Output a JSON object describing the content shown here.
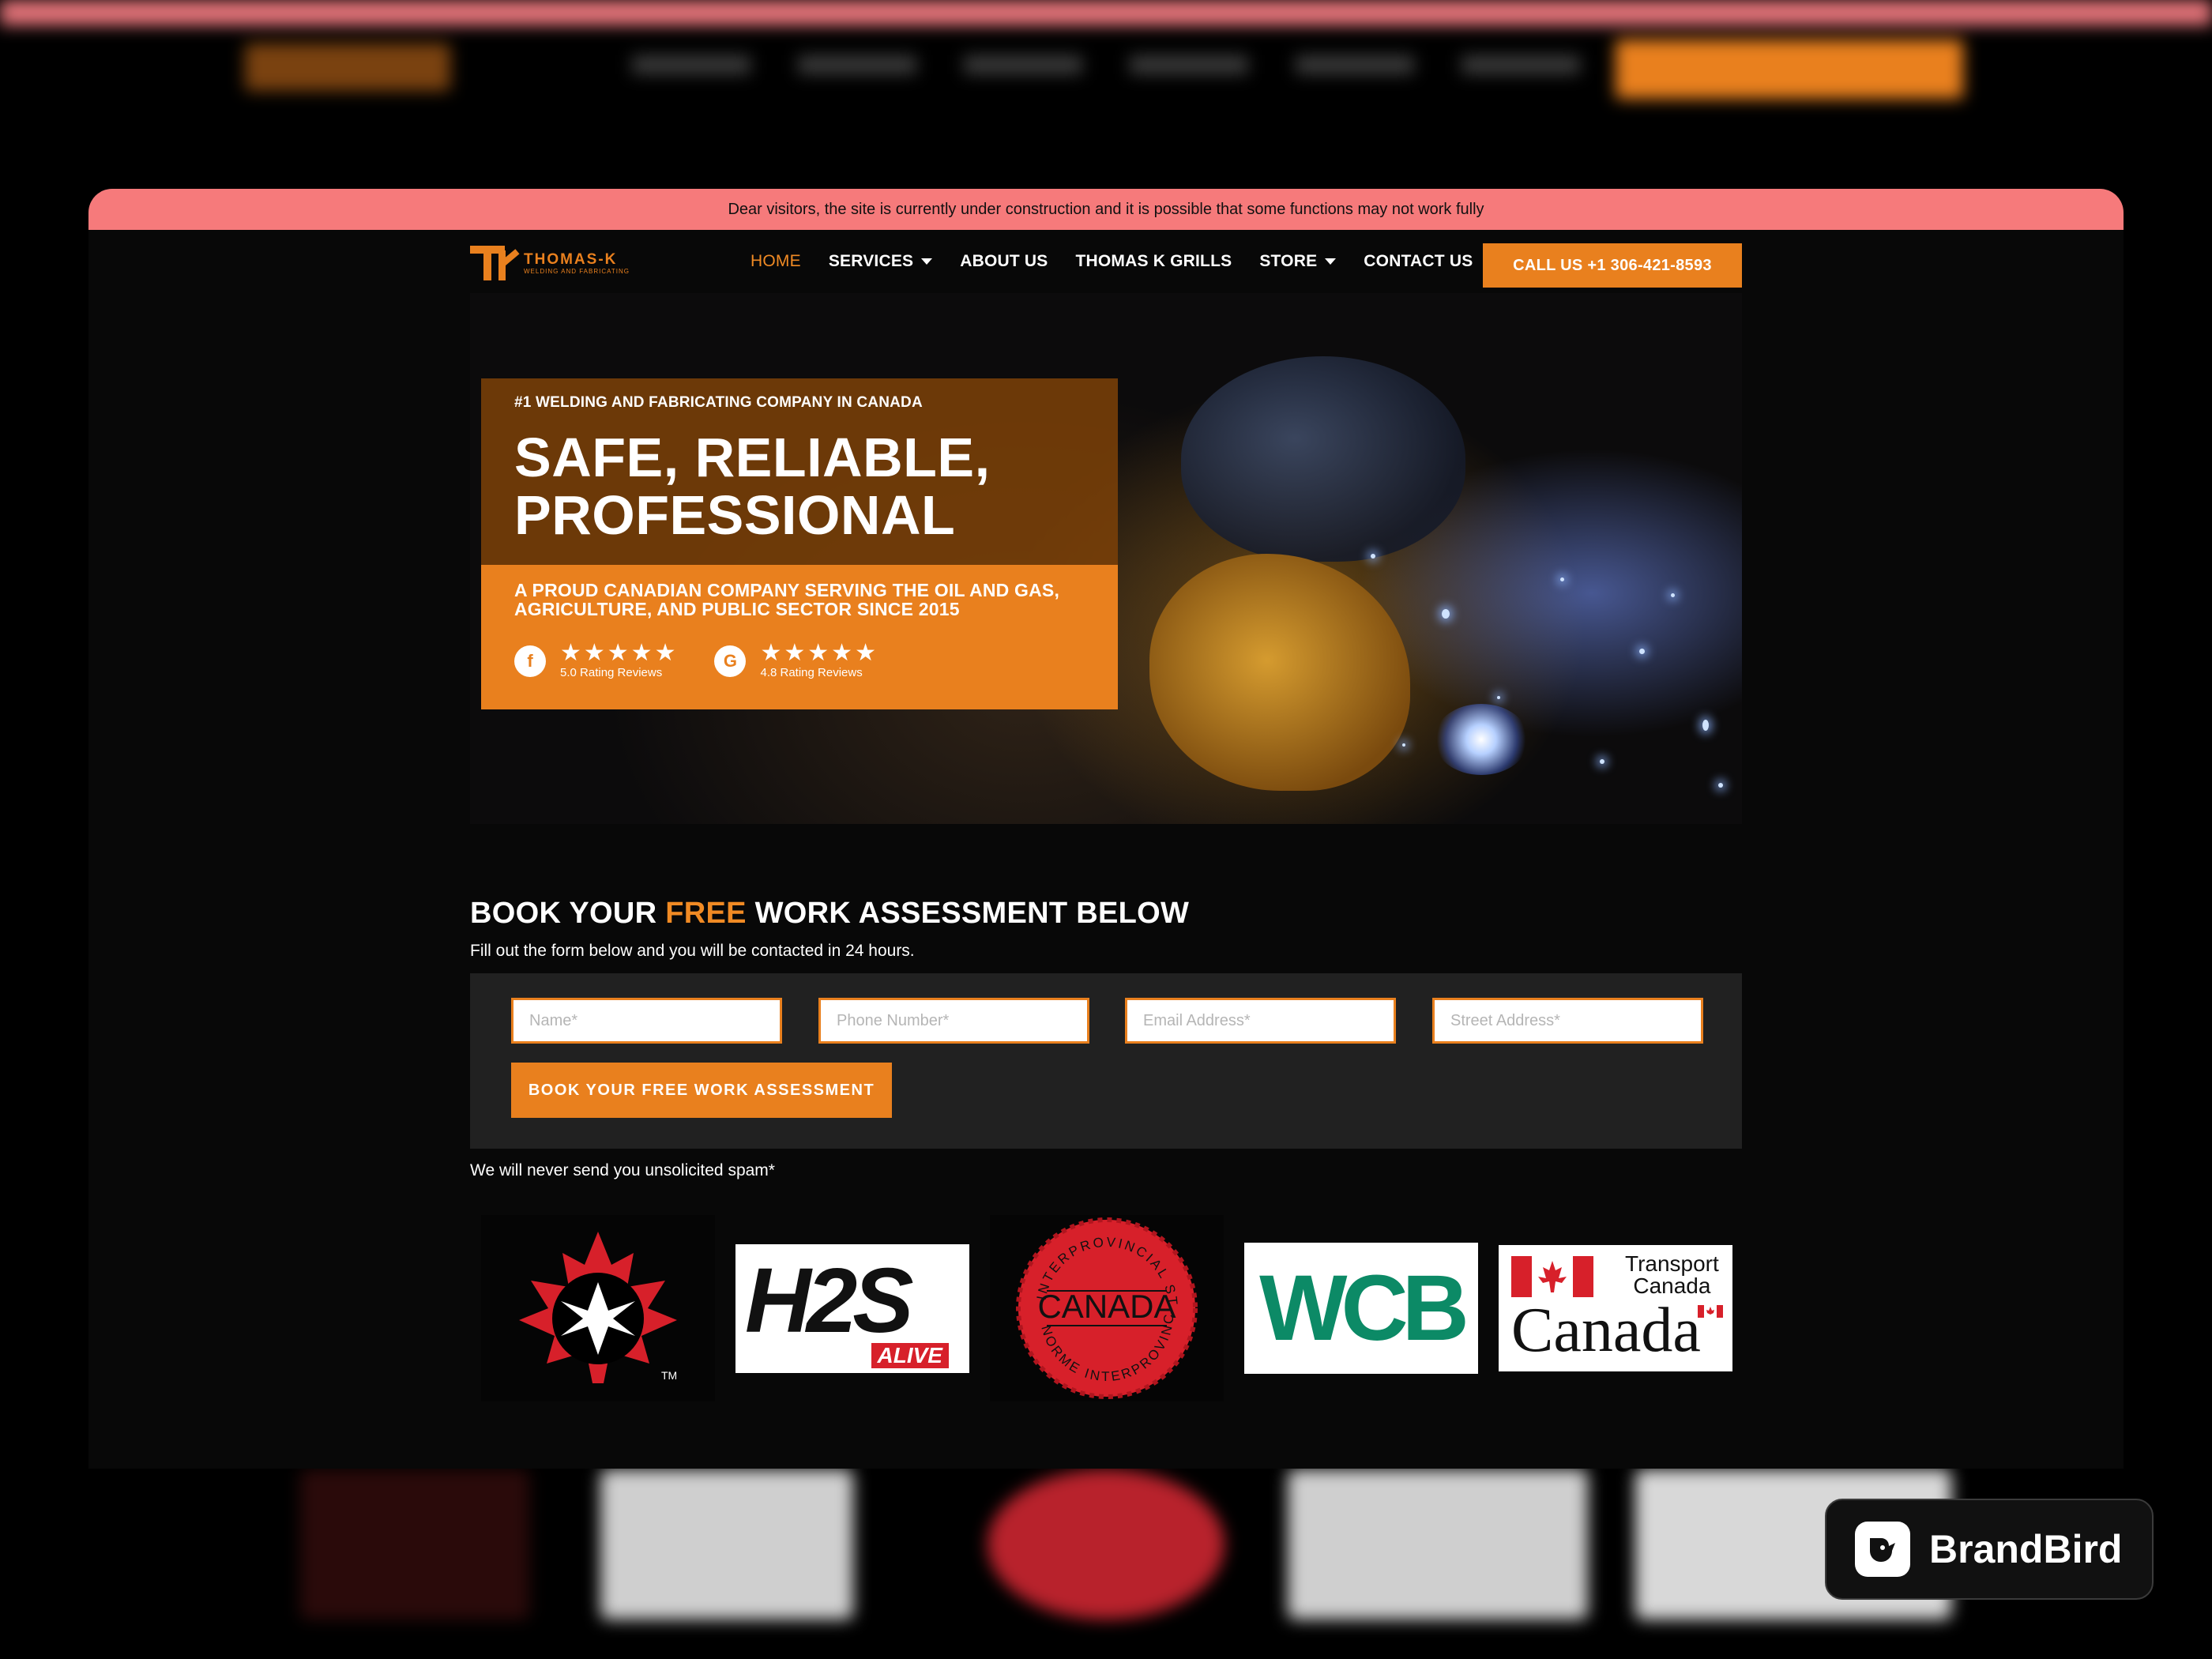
{
  "notice": "Dear visitors, the site is currently under construction and it is possible that some functions may not work fully",
  "brand": {
    "name": "THOMAS-K",
    "tagline": "WELDING AND FABRICATING",
    "accent": "#e9801e"
  },
  "nav": {
    "items": [
      {
        "label": "HOME",
        "active": true,
        "dropdown": false
      },
      {
        "label": "SERVICES",
        "active": false,
        "dropdown": true
      },
      {
        "label": "ABOUT US",
        "active": false,
        "dropdown": false
      },
      {
        "label": "THOMAS K GRILLS",
        "active": false,
        "dropdown": false
      },
      {
        "label": "STORE",
        "active": false,
        "dropdown": true
      },
      {
        "label": "CONTACT US",
        "active": false,
        "dropdown": false
      }
    ],
    "cta": "CALL US +1 306-421-8593"
  },
  "hero": {
    "eyebrow": "#1 WELDING AND FABRICATING COMPANY IN CANADA",
    "title_line1": "SAFE, RELIABLE,",
    "title_line2": "PROFESSIONAL",
    "subtitle_line1": "A PROUD CANADIAN COMPANY SERVING THE OIL AND GAS,",
    "subtitle_line2": "AGRICULTURE, AND PUBLIC SECTOR SINCE 2015",
    "ratings": [
      {
        "icon": "facebook-icon",
        "stars": "★★★★★",
        "text": "5.0 Rating Reviews"
      },
      {
        "icon": "google-icon",
        "stars": "★★★★★",
        "text": "4.8 Rating Reviews"
      }
    ]
  },
  "booking": {
    "title_prefix": "BOOK YOUR ",
    "title_highlight": "FREE",
    "title_suffix": " WORK ASSESSMENT BELOW",
    "subtitle": "Fill out the form below and you will be contacted in 24 hours.",
    "fields": {
      "name": "Name*",
      "phone": "Phone Number*",
      "email": "Email Address*",
      "street": "Street Address*"
    },
    "submit": "BOOK YOUR FREE WORK ASSESSMENT",
    "disclaimer": "We will never send you unsolicited spam*"
  },
  "certs": {
    "st_john_tm": "TM",
    "h2s_main": "H2S",
    "h2s_sub": "ALIVE",
    "interprovincial_top": "INTERPROVINCIAL STANDARD",
    "interprovincial_center": "CANADA",
    "interprovincial_bottom": "NORME INTERPROVINCIALE",
    "wcb": "WCB",
    "transport_line1": "Transport",
    "transport_line2": "Canada",
    "transport_wordmark": "Canada"
  },
  "watermark": "BrandBird"
}
